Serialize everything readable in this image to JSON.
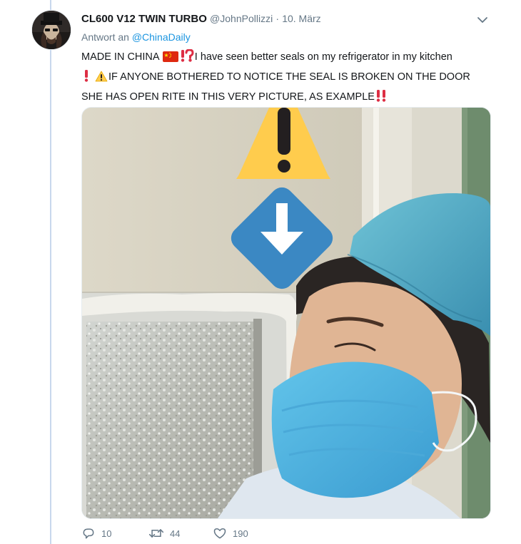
{
  "tweet": {
    "display_name": "CL600 V12 TWIN TURBO",
    "handle": "@JohnPollizzi",
    "separator": "·",
    "date": "10. März",
    "reply_prefix": "Antwort an",
    "reply_mention": "@ChinaDaily",
    "text": {
      "line1_start": "MADE IN CHINA",
      "line1_end": "I have seen better seals on my refrigerator in my kitchen",
      "line2": "IF ANYONE BOTHERED TO NOTICE THE SEAL IS BROKEN ON THE DOOR",
      "line3": "SHE HAS OPEN RITE IN THIS VERY PICTURE, AS EXAMPLE"
    },
    "icons": {
      "flag": "china-flag-icon",
      "interrobang": "exclamation-question-icon",
      "exclamation": "red-exclamation-icon",
      "warning": "warning-icon",
      "double_exclamation": "double-exclamation-icon"
    },
    "stats": {
      "replies": "10",
      "retweets": "44",
      "likes": "190"
    }
  },
  "colors": {
    "link": "#1b95e0",
    "secondary_text": "#657786",
    "primary_text": "#14171a",
    "thread_line": "#c8d7ed",
    "emoji_red": "#dd2e44",
    "warning_yellow": "#ffcc4d",
    "arrow_blue": "#3b88c3"
  }
}
